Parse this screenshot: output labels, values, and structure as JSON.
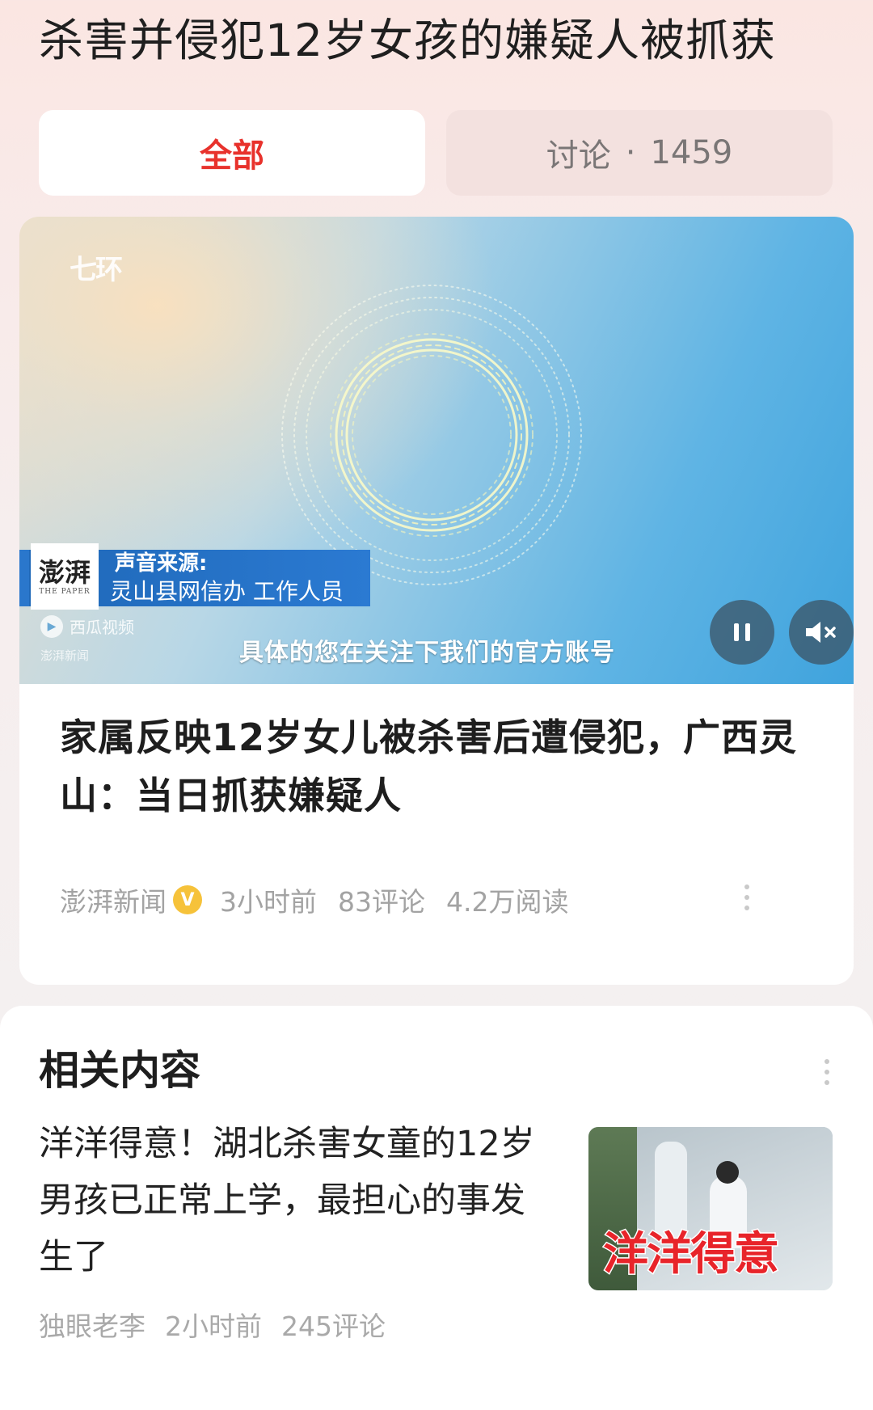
{
  "page": {
    "title": "杀害并侵犯12岁女孩的嫌疑人被抓获"
  },
  "tabs": {
    "all_label": "全部",
    "discuss_label": "讨论",
    "discuss_separator": "·",
    "discuss_count": "1459"
  },
  "video": {
    "watermark_logo": "七环",
    "caption_source_label": "声音来源:",
    "caption_source_value": "灵山县网信办 工作人员",
    "paper_logo_text": "澎湃",
    "paper_logo_sub": "THE PAPER",
    "xigua_label": "西瓜视频",
    "pengpai_small": "澎湃新闻",
    "subtitle": "具体的您在关注下我们的官方账号",
    "pause_icon": "pause-icon",
    "mute_icon": "mute-icon"
  },
  "article": {
    "headline": "家属反映12岁女儿被杀害后遭侵犯，广西灵山：当日抓获嫌疑人",
    "source": "澎湃新闻",
    "verified_mark": "V",
    "time": "3小时前",
    "comments": "83评论",
    "reads": "4.2万阅读"
  },
  "related": {
    "section_title": "相关内容",
    "item": {
      "title": "洋洋得意！湖北杀害女童的12岁男孩已正常上学，最担心的事发生了",
      "thumb_text": "洋洋得意",
      "author": "独眼老李",
      "time": "2小时前",
      "comments": "245评论"
    }
  },
  "colors": {
    "accent_red": "#e8322c",
    "verified_gold": "#f6c23a"
  }
}
